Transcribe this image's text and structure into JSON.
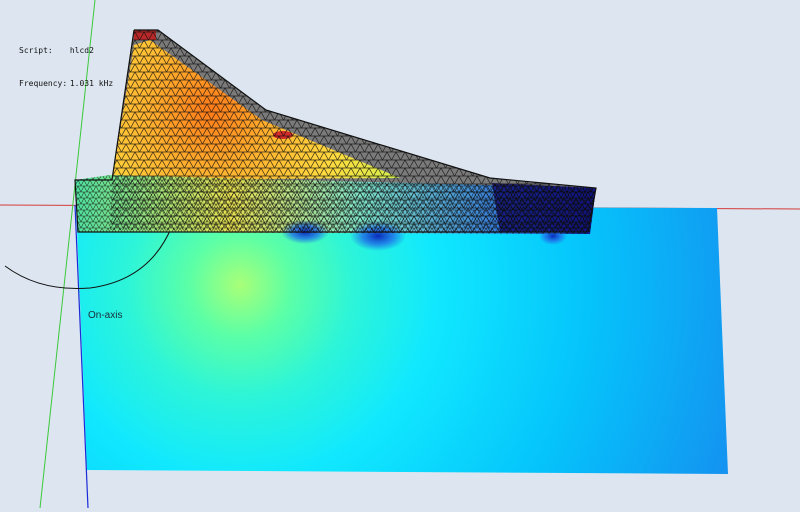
{
  "info": {
    "script_label": "Script:",
    "script_value": "hlcd2",
    "frequency_label": "Frequency:",
    "frequency_value": "1.031 kHz"
  },
  "viewport": {
    "axis_label": "On-axis",
    "background_color": "#dde6f0",
    "field_colors": [
      "#00e5ff",
      "#3dffc4",
      "#9eff66",
      "#ffd23a",
      "#ff8a1a",
      "#d42a2a"
    ]
  }
}
